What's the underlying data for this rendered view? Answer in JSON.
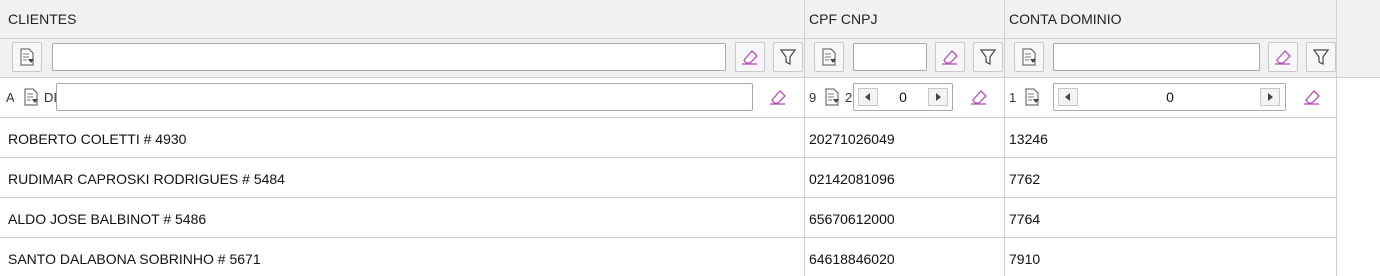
{
  "columns": [
    {
      "header": "CLIENTES"
    },
    {
      "header": "CPF CNPJ"
    },
    {
      "header": "CONTA DOMINIO"
    }
  ],
  "filter_row": {
    "clientes_value": "",
    "cpf_value": "",
    "conta_value": ""
  },
  "edit_row": {
    "clientes_value": "",
    "clientes_fragment": "A",
    "clientes_fragment2": "DI",
    "cpf_fragment": "9",
    "cpf_fragment2": "2",
    "cpf_spin_value": "0",
    "conta_fragment": "1",
    "conta_spin_value": "0"
  },
  "rows": [
    {
      "cliente": "ROBERTO COLETTI # 4930",
      "cpf": "20271026049",
      "conta": "13246"
    },
    {
      "cliente": "RUDIMAR CAPROSKI RODRIGUES # 5484",
      "cpf": "02142081096",
      "conta": "7762"
    },
    {
      "cliente": "ALDO JOSE BALBINOT # 5486",
      "cpf": "65670612000",
      "conta": "7764"
    },
    {
      "cliente": "SANTO DALABONA SOBRINHO # 5671",
      "cpf": "64618846020",
      "conta": "7910"
    }
  ],
  "icons": {
    "copy": "document-arrow-icon",
    "clear": "eraser-icon",
    "filter": "funnel-icon",
    "spin_left": "triangle-left-icon",
    "spin_right": "triangle-right-icon"
  },
  "colors": {
    "header_bg": "#f1f1f1",
    "grid": "#cfcfcf",
    "eraser": "#b84fb8"
  }
}
